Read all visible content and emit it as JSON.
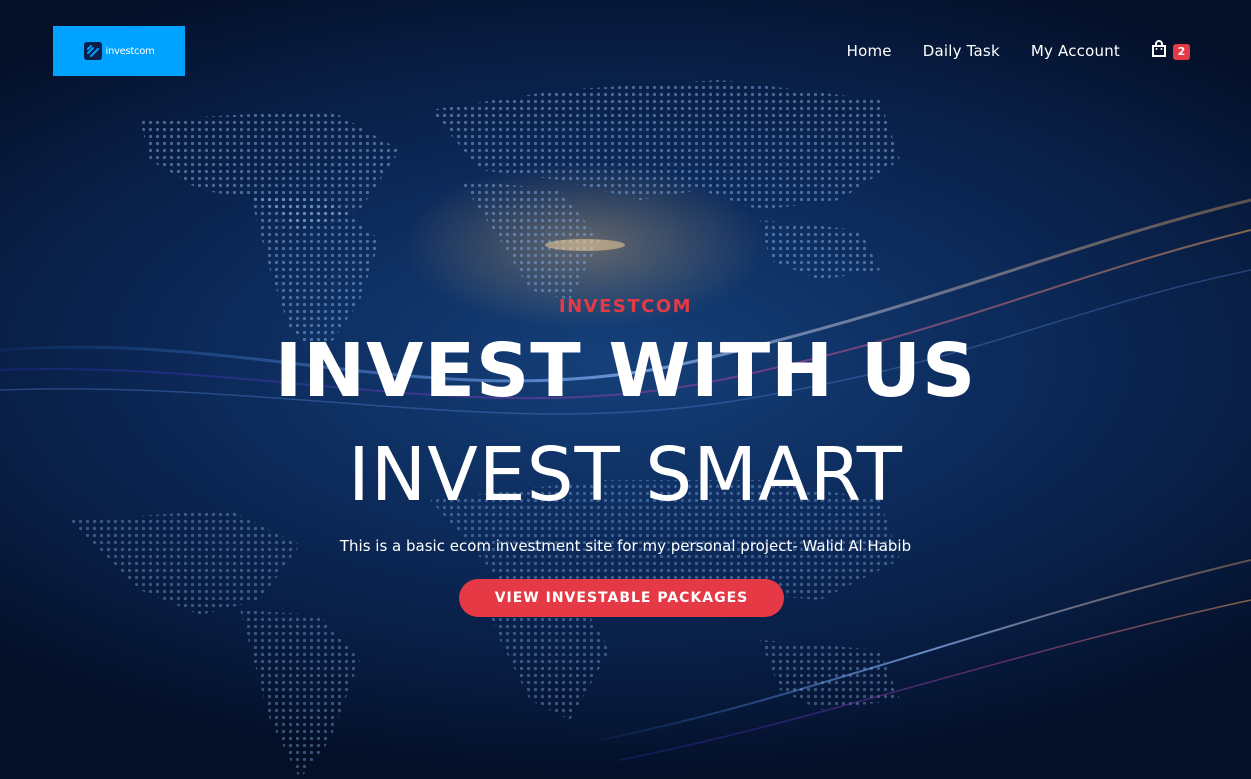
{
  "header": {
    "logo": {
      "text": "investcom",
      "icon": "logo-mark-icon"
    },
    "nav": [
      {
        "label": "Home"
      },
      {
        "label": "Daily Task"
      },
      {
        "label": "My Account"
      }
    ],
    "cart": {
      "icon": "shopping-bag-icon",
      "count": "2"
    }
  },
  "hero": {
    "eyebrow": "INVESTCOM",
    "headline": "INVEST WITH US",
    "subheadline": "INVEST SMART",
    "description": "This is a basic ecom investment site for my personal project- Walid Al Habib",
    "cta_label": "VIEW INVESTABLE PACKAGES"
  },
  "colors": {
    "accent": "#e53946",
    "logo_bg": "#00a2ff",
    "background": "#0c2a5a",
    "text": "#ffffff"
  }
}
